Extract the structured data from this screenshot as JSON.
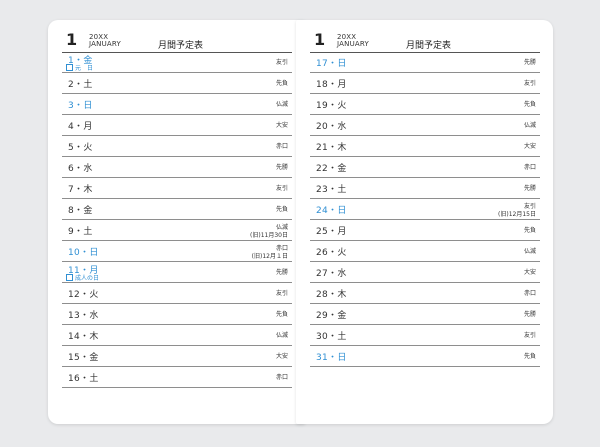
{
  "left": {
    "month": "1",
    "year": "20XX",
    "month_en": "JANUARY",
    "title": "月間予定表",
    "rows": [
      {
        "date": "1・金",
        "rokuyo": "友引",
        "holiday": "元　日",
        "blue": true
      },
      {
        "date": "2・土",
        "rokuyo": "先負"
      },
      {
        "date": "3・日",
        "rokuyo": "仏滅",
        "blue": true
      },
      {
        "date": "4・月",
        "rokuyo": "大安"
      },
      {
        "date": "5・火",
        "rokuyo": "赤口"
      },
      {
        "date": "6・水",
        "rokuyo": "先勝"
      },
      {
        "date": "7・木",
        "rokuyo": "友引"
      },
      {
        "date": "8・金",
        "rokuyo": "先負"
      },
      {
        "date": "9・土",
        "rokuyo": "仏滅",
        "note": "(旧)11月30日"
      },
      {
        "date": "10・日",
        "rokuyo": "赤口",
        "note": "(旧)12月１日",
        "blue": true
      },
      {
        "date": "11・月",
        "rokuyo": "先勝",
        "holiday": "成人の日",
        "blue": true
      },
      {
        "date": "12・火",
        "rokuyo": "友引"
      },
      {
        "date": "13・水",
        "rokuyo": "先負"
      },
      {
        "date": "14・木",
        "rokuyo": "仏滅"
      },
      {
        "date": "15・金",
        "rokuyo": "大安"
      },
      {
        "date": "16・土",
        "rokuyo": "赤口"
      }
    ]
  },
  "right": {
    "month": "1",
    "year": "20XX",
    "month_en": "JANUARY",
    "title": "月間予定表",
    "rows": [
      {
        "date": "17・日",
        "rokuyo": "先勝",
        "blue": true
      },
      {
        "date": "18・月",
        "rokuyo": "友引"
      },
      {
        "date": "19・火",
        "rokuyo": "先負"
      },
      {
        "date": "20・水",
        "rokuyo": "仏滅"
      },
      {
        "date": "21・木",
        "rokuyo": "大安"
      },
      {
        "date": "22・金",
        "rokuyo": "赤口"
      },
      {
        "date": "23・土",
        "rokuyo": "先勝"
      },
      {
        "date": "24・日",
        "rokuyo": "友引",
        "note": "(旧)12月15日",
        "blue": true
      },
      {
        "date": "25・月",
        "rokuyo": "先負"
      },
      {
        "date": "26・火",
        "rokuyo": "仏滅"
      },
      {
        "date": "27・水",
        "rokuyo": "大安"
      },
      {
        "date": "28・木",
        "rokuyo": "赤口"
      },
      {
        "date": "29・金",
        "rokuyo": "先勝"
      },
      {
        "date": "30・土",
        "rokuyo": "友引"
      },
      {
        "date": "31・日",
        "rokuyo": "先負",
        "blue": true
      }
    ]
  }
}
